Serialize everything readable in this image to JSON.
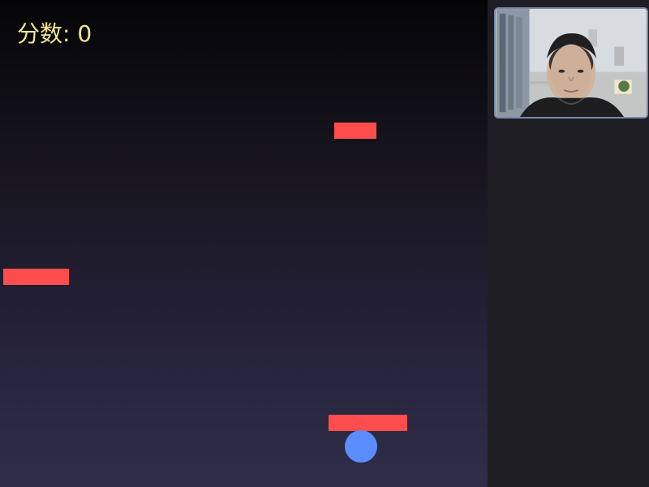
{
  "game": {
    "score_label": "分数: 0",
    "score_value": 0
  },
  "colors": {
    "score_text": "#f3e68b",
    "platform": "#ff4d4d",
    "ball": "#5b8dff",
    "panel_bg": "#1d1d23",
    "webcam_border": "#7b89aa"
  },
  "sidebar": {
    "webcam_feed": "webcam-feed"
  }
}
